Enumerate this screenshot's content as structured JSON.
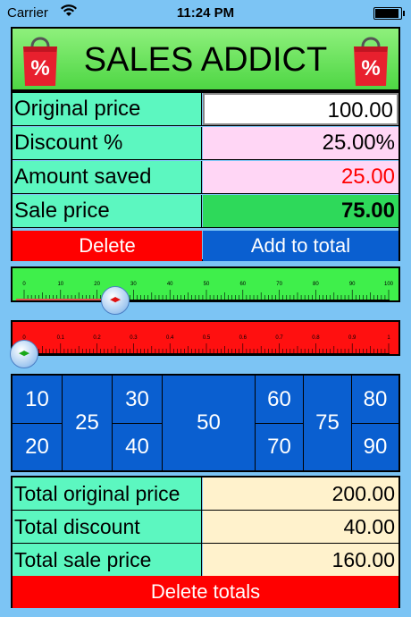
{
  "status_bar": {
    "carrier": "Carrier",
    "time": "11:24 PM"
  },
  "header": {
    "title": "SALES ADDICT",
    "bag_symbol": "%",
    "bag_color": "#e8202e"
  },
  "calculator": {
    "rows": [
      {
        "label": "Original price",
        "value": "100.00"
      },
      {
        "label": "Discount %",
        "value": "25.00%"
      },
      {
        "label": "Amount saved",
        "value": "25.00"
      },
      {
        "label": "Sale price",
        "value": "75.00"
      }
    ],
    "delete_label": "Delete",
    "add_label": "Add to total"
  },
  "price_slider": {
    "tick_labels": [
      "0",
      "10",
      "20",
      "30",
      "40",
      "50",
      "60",
      "70",
      "80",
      "90",
      "100"
    ],
    "value": 25,
    "max": 100,
    "color": "#3fef4b"
  },
  "discount_slider": {
    "tick_labels": [
      "0",
      "0.1",
      "0.2",
      "0.3",
      "0.4",
      "0.5",
      "0.6",
      "0.7",
      "0.8",
      "0.9",
      "1"
    ],
    "value": 0,
    "max": 1,
    "color": "#ff1010"
  },
  "discount_buttons": [
    "10",
    "20",
    "25",
    "30",
    "40",
    "50",
    "60",
    "70",
    "75",
    "80",
    "90"
  ],
  "totals": {
    "rows": [
      {
        "label": "Total original price",
        "value": "200.00"
      },
      {
        "label": "Total discount",
        "value": "40.00"
      },
      {
        "label": "Total sale price",
        "value": "160.00"
      }
    ],
    "delete_totals_label": "Delete totals"
  }
}
